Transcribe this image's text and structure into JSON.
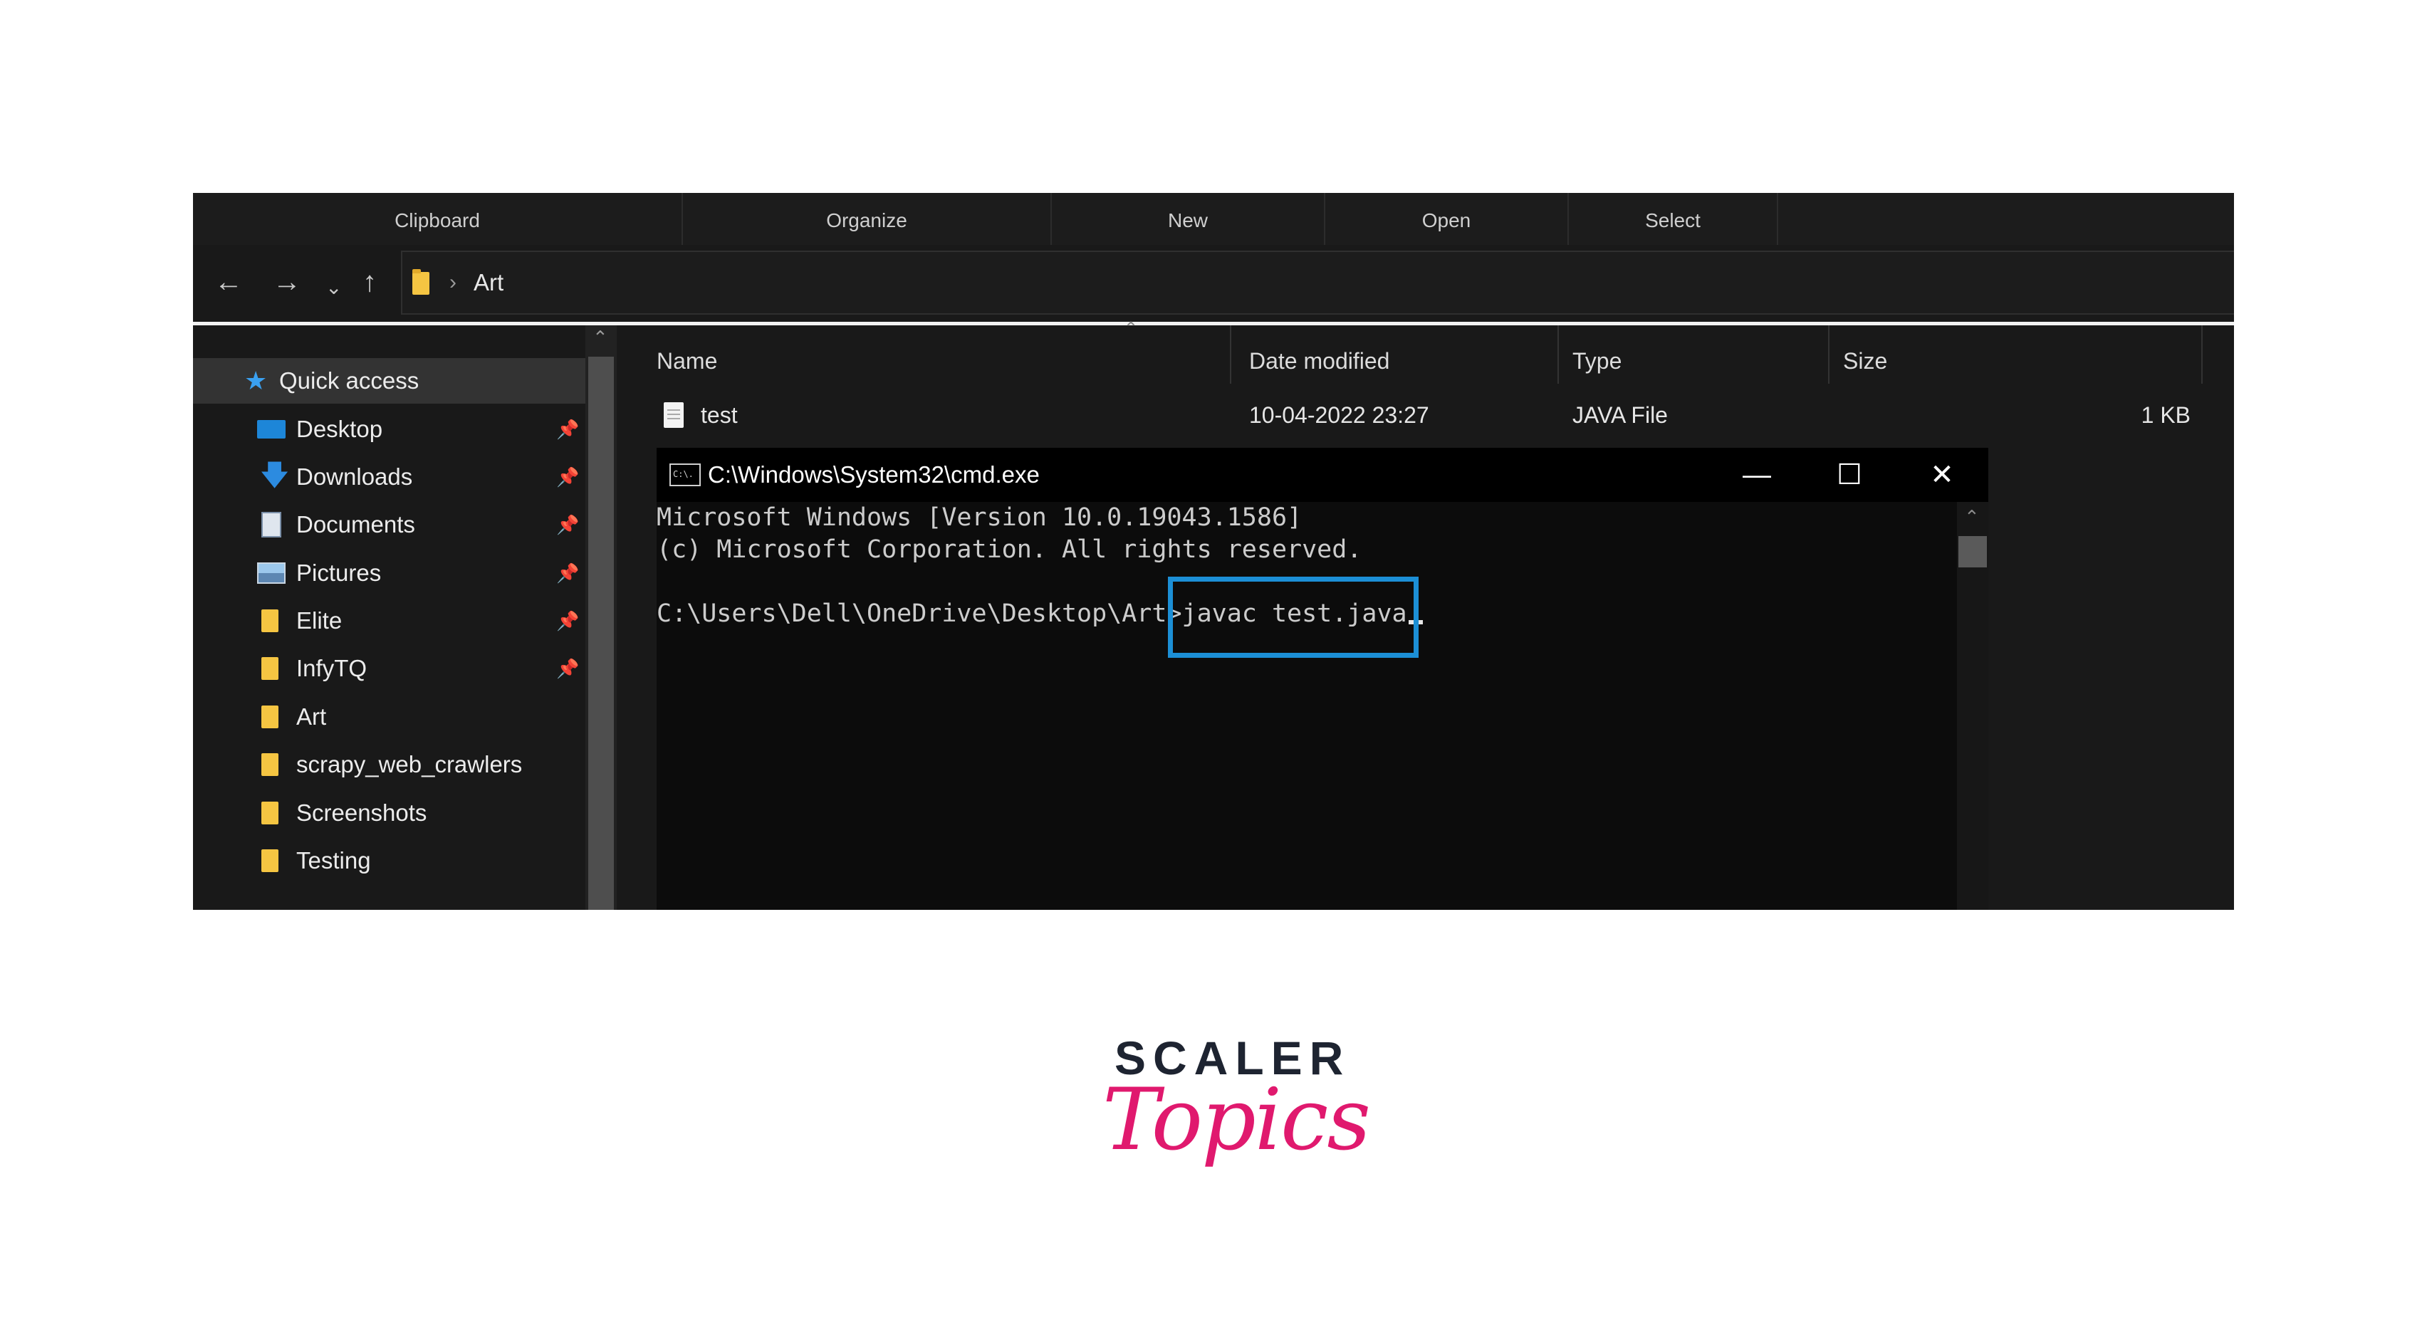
{
  "ribbon": {
    "groups": [
      "Clipboard",
      "Organize",
      "New",
      "Open",
      "Select"
    ]
  },
  "nav": {
    "back_icon": "arrow-left-icon",
    "forward_icon": "arrow-right-icon",
    "recent_icon": "chevron-down-icon",
    "up_icon": "arrow-up-icon",
    "breadcrumb": "Art",
    "refresh_icon": "refresh-icon"
  },
  "sidebar": {
    "quick_access": "Quick access",
    "items": [
      {
        "label": "Desktop",
        "icon": "desktop-icon",
        "pinned": true
      },
      {
        "label": "Downloads",
        "icon": "download-icon",
        "pinned": true
      },
      {
        "label": "Documents",
        "icon": "documents-icon",
        "pinned": true
      },
      {
        "label": "Pictures",
        "icon": "pictures-icon",
        "pinned": true
      },
      {
        "label": "Elite",
        "icon": "folder-icon",
        "pinned": true
      },
      {
        "label": "InfyTQ",
        "icon": "folder-icon",
        "pinned": true
      },
      {
        "label": "Art",
        "icon": "folder-icon",
        "pinned": false
      },
      {
        "label": "scrapy_web_crawlers",
        "icon": "folder-icon",
        "pinned": false
      },
      {
        "label": "Screenshots",
        "icon": "folder-icon",
        "pinned": false
      },
      {
        "label": "Testing",
        "icon": "folder-icon",
        "pinned": false
      }
    ]
  },
  "files": {
    "columns": [
      "Name",
      "Date modified",
      "Type",
      "Size"
    ],
    "rows": [
      {
        "name": "test",
        "date": "10-04-2022 23:27",
        "type": "JAVA File",
        "size": "1 KB"
      }
    ]
  },
  "cmd": {
    "title": "C:\\Windows\\System32\\cmd.exe",
    "icon_text": "C:\\.",
    "lines": [
      "Microsoft Windows [Version 10.0.19043.1586]",
      "(c) Microsoft Corporation. All rights reserved.",
      "C:\\Users\\Dell\\OneDrive\\Desktop\\Art>javac test.java"
    ]
  },
  "logo": {
    "top": "SCALER",
    "bottom": "Topics"
  },
  "colors": {
    "highlight": "#1c8fd6",
    "accent_pink": "#e0196e"
  }
}
